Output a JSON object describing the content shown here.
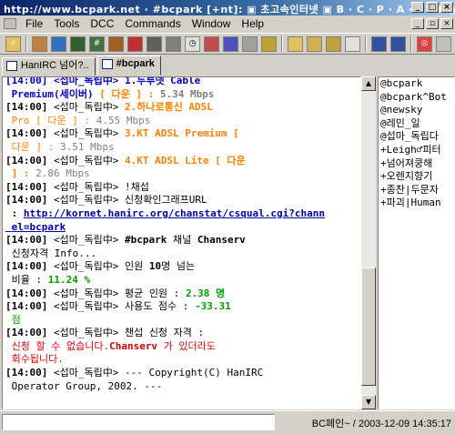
{
  "titlebar": {
    "title": "http://www.bcpark.net  · #bcpark [+nt]: ▣ 초고속인터넷 ▣ B · C · P · A · R · K ▣ 다"
  },
  "menu": [
    "File",
    "Tools",
    "DCC",
    "Commands",
    "Window",
    "Help"
  ],
  "tabs": [
    {
      "label": "HanIRC 넘어?..",
      "active": false
    },
    {
      "label": "#bcpark",
      "active": true
    }
  ],
  "colors": {
    "title_start": "#0a246a",
    "nick_text": "#000000",
    "speed_blue": "#0000cc",
    "orange": "#ff8000",
    "green": "#00a000",
    "red": "#e00000",
    "link": "#0000aa"
  },
  "chat": {
    "lines": [
      [
        {
          "t": "[14:00] <섭마_독립中> ",
          "c": "b blue"
        },
        {
          "t": "1.두루넷 Cable",
          "c": "b blue"
        }
      ],
      [
        {
          "t": " Premium(세이버) ",
          "c": "b blue"
        },
        {
          "t": "[ 다운 ] : ",
          "c": "b orange"
        },
        {
          "t": "5.34 Mbps",
          "c": "b gray"
        }
      ],
      [
        {
          "t": "[14:00] ",
          "c": "b"
        },
        {
          "t": "<섭마_독립中> ",
          "c": ""
        },
        {
          "t": "2.하나로통신 ADSL",
          "c": "b orange"
        }
      ],
      [
        {
          "t": " Pro [ 다운 ] : ",
          "c": "orange"
        },
        {
          "t": "4.55 Mbps",
          "c": "gray"
        }
      ],
      [
        {
          "t": "[14:00] ",
          "c": "b"
        },
        {
          "t": "<섭마_독립中> ",
          "c": ""
        },
        {
          "t": "3.KT ADSL Premium [",
          "c": "b orange"
        }
      ],
      [
        {
          "t": " 다운 ] : ",
          "c": "orange"
        },
        {
          "t": "3.51 Mbps",
          "c": "gray"
        }
      ],
      [
        {
          "t": "[14:00] ",
          "c": "b"
        },
        {
          "t": "<섭마_독립中> ",
          "c": ""
        },
        {
          "t": "4.KT ADSL Lite [ 다운",
          "c": "b orange"
        }
      ],
      [
        {
          "t": " ] : ",
          "c": "b orange"
        },
        {
          "t": "2.86 Mbps",
          "c": "gray"
        }
      ],
      [
        {
          "t": "[14:00] ",
          "c": "b"
        },
        {
          "t": "<섭마_독립中> !채섭",
          "c": ""
        }
      ],
      [
        {
          "t": "[14:00] ",
          "c": "b"
        },
        {
          "t": "<섭마_독립中> 신청확인그래프URL",
          "c": ""
        }
      ],
      [
        {
          "t": " : ",
          "c": "b"
        },
        {
          "t": "http://kornet.hanirc.org/chanstat/csqual.cgi?chann",
          "c": "link"
        }
      ],
      [
        {
          "t": " el=bcpark",
          "c": "link"
        }
      ],
      [
        {
          "t": "[14:00] ",
          "c": "b"
        },
        {
          "t": "<섭마_독립中> ",
          "c": ""
        },
        {
          "t": "#bcpark",
          "c": "b"
        },
        {
          "t": " 채널 ",
          "c": ""
        },
        {
          "t": "Chanserv",
          "c": "b"
        }
      ],
      [
        {
          "t": " 신청자격 Info...",
          "c": ""
        }
      ],
      [
        {
          "t": "[14:00] ",
          "c": "b"
        },
        {
          "t": "<섭마_독립中> 인원 ",
          "c": ""
        },
        {
          "t": "10",
          "c": "b"
        },
        {
          "t": "명 넘는",
          "c": ""
        }
      ],
      [
        {
          "t": " 비율 : ",
          "c": ""
        },
        {
          "t": "11.24 %",
          "c": "b green"
        }
      ],
      [
        {
          "t": "[14:00] ",
          "c": "b"
        },
        {
          "t": "<섭마_독립中> 평균 인원 : ",
          "c": ""
        },
        {
          "t": "2.38 명",
          "c": "b green"
        }
      ],
      [
        {
          "t": "[14:00] ",
          "c": "b"
        },
        {
          "t": "<섭마_독립中> 사용도 점수 : ",
          "c": ""
        },
        {
          "t": "-33.31",
          "c": "b green"
        }
      ],
      [
        {
          "t": " 점",
          "c": "green"
        }
      ],
      [
        {
          "t": "[14:00] ",
          "c": "b"
        },
        {
          "t": "<섭마_독립中> 챈섭 신청 자격 :",
          "c": ""
        }
      ],
      [
        {
          "t": " 신청 할 수 없습니다.",
          "c": "red"
        },
        {
          "t": "Chanserv",
          "c": "b red"
        },
        {
          "t": " 가 있더라도",
          "c": "red"
        }
      ],
      [
        {
          "t": " 회수됩니다.",
          "c": "red"
        }
      ],
      [
        {
          "t": "[14:00] ",
          "c": "b"
        },
        {
          "t": "<섭마_독립中> --- Copyright(C) HanIRC",
          "c": ""
        }
      ],
      [
        {
          "t": " Operator Group, 2002. ---",
          "c": ""
        }
      ]
    ]
  },
  "nicklist": [
    "@bcpark",
    "@bcpark^Bot",
    "@newsky",
    "@레민_일",
    "@섭마_독립다",
    "+Leigh♂피터",
    "+넘어져쿵해",
    "+오렌지향기",
    "+종찬|두문자",
    "+파괴|Human"
  ],
  "statusbar": {
    "text": "BC페인~ / 2003-12-09 14:35:17"
  }
}
